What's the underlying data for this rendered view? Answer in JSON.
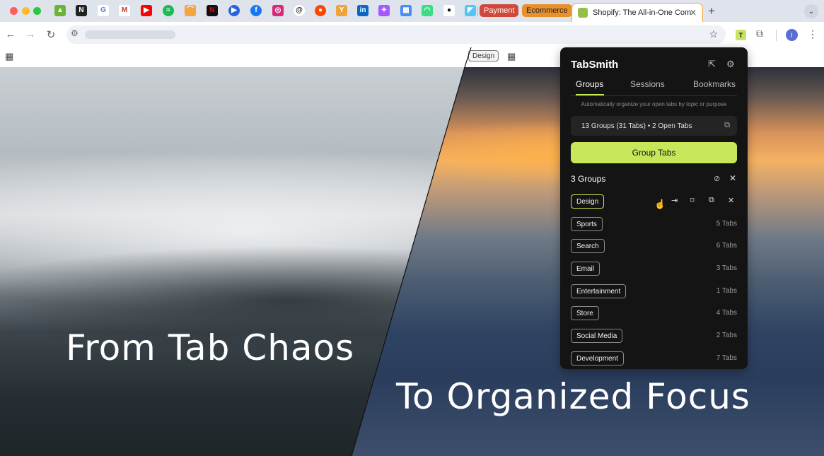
{
  "browser": {
    "tab_groups": [
      {
        "label": "Payment",
        "color": "#d0483a"
      },
      {
        "label": "Ecommerce",
        "color": "#e8912c"
      }
    ],
    "active_tab": {
      "title": "Shopify: The All-in-One Commerce Platform",
      "close": "✕"
    },
    "new_tab": "+",
    "tab_list": "⌄",
    "profile_initial": "I",
    "extension_label": "T"
  },
  "bookmarks": {
    "design_label": "Design"
  },
  "hero": {
    "left_text": "From Tab Chaos",
    "right_text": "To Organized Focus"
  },
  "popup": {
    "title": "TabSmith",
    "tabs": [
      "Groups",
      "Sessions",
      "Bookmarks"
    ],
    "description": "Automatically organize your open tabs by topic or purpose",
    "summary": "13 Groups (31 Tabs) • 2 Open Tabs",
    "group_button": "Group Tabs",
    "groups_heading": "3 Groups",
    "groups": [
      {
        "name": "Design",
        "count": ""
      },
      {
        "name": "Sports",
        "count": "5 Tabs"
      },
      {
        "name": "Search",
        "count": "6 Tabs"
      },
      {
        "name": "Email",
        "count": "3 Tabs"
      },
      {
        "name": "Entertainment",
        "count": "1 Tabs"
      },
      {
        "name": "Store",
        "count": "4 Tabs"
      },
      {
        "name": "Social Media",
        "count": "2 Tabs"
      },
      {
        "name": "Development",
        "count": "7 Tabs"
      }
    ],
    "accent": "#c7e65a"
  }
}
